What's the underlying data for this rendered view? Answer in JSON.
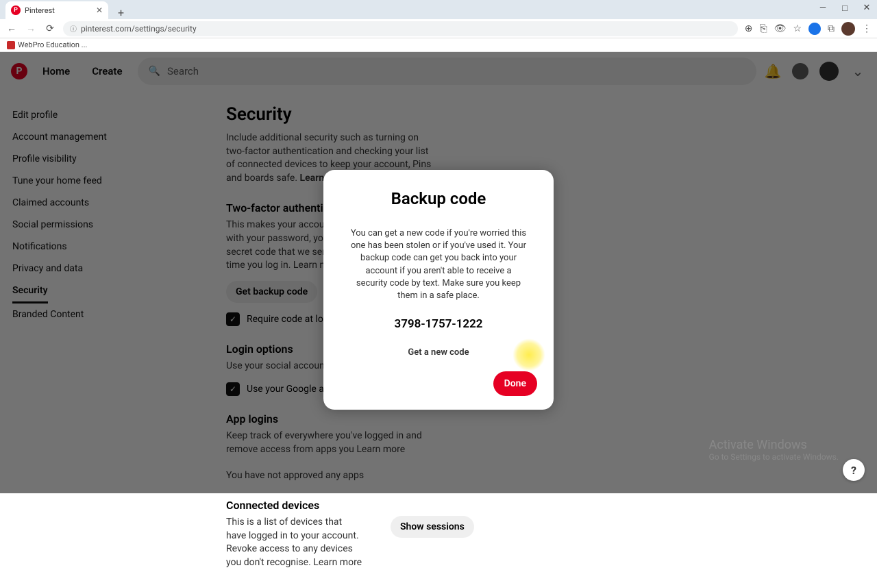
{
  "browser": {
    "tab_title": "Pinterest",
    "url": "pinterest.com/settings/security",
    "bookmark": "WebPro Education ..."
  },
  "header": {
    "nav_home": "Home",
    "nav_create": "Create",
    "search_placeholder": "Search"
  },
  "sidebar": {
    "items": [
      {
        "label": "Edit profile"
      },
      {
        "label": "Account management"
      },
      {
        "label": "Profile visibility"
      },
      {
        "label": "Tune your home feed"
      },
      {
        "label": "Claimed accounts"
      },
      {
        "label": "Social permissions"
      },
      {
        "label": "Notifications"
      },
      {
        "label": "Privacy and data"
      },
      {
        "label": "Security"
      },
      {
        "label": "Branded Content"
      }
    ]
  },
  "page": {
    "title": "Security",
    "desc": "Include additional security such as turning on two-factor authentication and checking your list of connected devices to keep your account, Pins and boards safe.",
    "learn_more": "Learn more",
    "twofa_h": "Two-factor authentication",
    "twofa_d": "This makes your account extra secure. Along with your password, you'll need to enter the secret code that we send to your phone each time you log in.",
    "backup_btn": "Get backup code",
    "require_code": "Require code at login",
    "login_h": "Login options",
    "login_d": "Use your social account to log in",
    "google_chk": "Use your Google account to",
    "app_h": "App logins",
    "app_d": "Keep track of everywhere you've logged in and remove access from apps you",
    "app_none": "You have not approved any apps",
    "devices_h": "Connected devices",
    "devices_d": "This is a list of devices that have logged in to your account. Revoke access to any devices you don't recognise.",
    "show_sessions": "Show sessions"
  },
  "modal": {
    "title": "Backup code",
    "body": "You can get a new code if you're worried this one has been stolen or if you've used it. Your backup code can get you back into your account if you aren't able to receive a security code by text. Make sure you keep them in a safe place.",
    "code": "3798-1757-1222",
    "new_code": "Get a new code",
    "done": "Done"
  },
  "watermark": {
    "line1": "Activate Windows",
    "line2": "Go to Settings to activate Windows."
  },
  "help": "?"
}
